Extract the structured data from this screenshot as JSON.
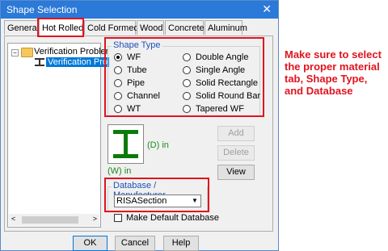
{
  "window": {
    "title": "Shape Selection",
    "close_glyph": "✕"
  },
  "tabs": [
    {
      "label": "General"
    },
    {
      "label": "Hot Rolled"
    },
    {
      "label": "Cold Formed"
    },
    {
      "label": "Wood"
    },
    {
      "label": "Concrete"
    },
    {
      "label": "Aluminum"
    }
  ],
  "active_tab": "Hot Rolled",
  "tree": {
    "root_label": "Verification Probler",
    "child_label": "Verification Pro",
    "expander": "−"
  },
  "shape_type": {
    "legend": "Shape Type",
    "options": [
      {
        "label": "WF",
        "selected": true
      },
      {
        "label": "Tube",
        "selected": false
      },
      {
        "label": "Pipe",
        "selected": false
      },
      {
        "label": "Channel",
        "selected": false
      },
      {
        "label": "WT",
        "selected": false
      },
      {
        "label": "Double Angle",
        "selected": false
      },
      {
        "label": "Single Angle",
        "selected": false
      },
      {
        "label": "Solid Rectangle",
        "selected": false
      },
      {
        "label": "Solid Round Bar",
        "selected": false
      },
      {
        "label": "Tapered WF",
        "selected": false
      }
    ]
  },
  "preview": {
    "d_label": "(D) in",
    "w_label": "(W) in"
  },
  "side_buttons": {
    "add": "Add",
    "delete": "Delete",
    "view": "View"
  },
  "database": {
    "legend": "Database / Manufacturer",
    "value": "RISASection",
    "make_default_label": "Make Default Database"
  },
  "footer": {
    "ok": "OK",
    "cancel": "Cancel",
    "help": "Help"
  },
  "annotation": {
    "text": "Make sure to select the proper material tab, Shape Type, and Database",
    "color": "#e0141e"
  }
}
